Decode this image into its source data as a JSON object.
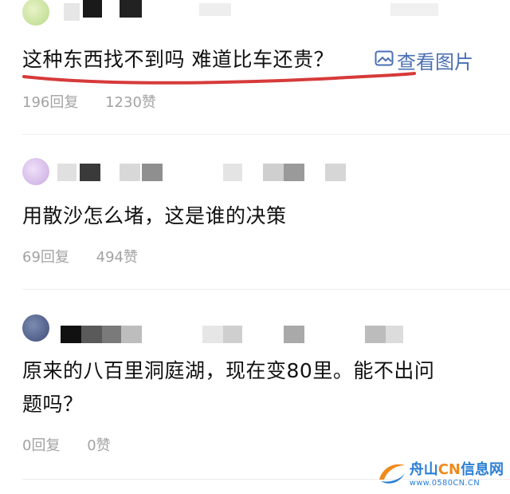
{
  "comments": [
    {
      "text": "这种东西找不到吗 难道比车还贵？",
      "view_images": "查看图片",
      "replies": "196回复",
      "likes": "1230赞"
    },
    {
      "text": "用散沙怎么堵，这是谁的决策",
      "replies": "69回复",
      "likes": "494赞"
    },
    {
      "text_line1": "原来的八百里洞庭湖，现在变80里。能不出问",
      "text_line2": "题吗？",
      "replies": "0回复",
      "likes": "0赞"
    }
  ],
  "watermark": {
    "cn_a": "舟山",
    "cn_b": "CN",
    "cn_c": "信息网",
    "url": "www.0580CN.CN"
  },
  "colors": {
    "link": "#4a6fb3",
    "underline": "#d63a3a",
    "meta": "#a3a3a3"
  },
  "icons": {
    "view_images": "image-icon",
    "watermark": "swoosh-logo-icon"
  }
}
